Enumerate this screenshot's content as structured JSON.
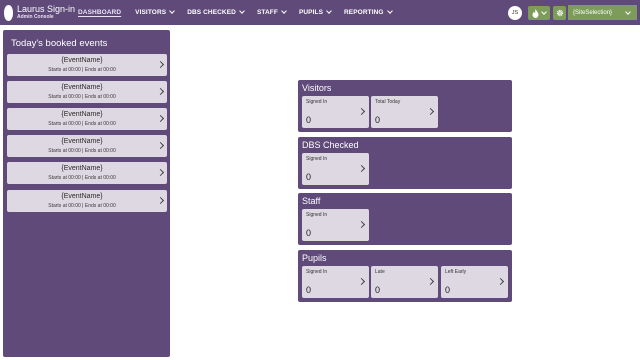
{
  "app": {
    "title": "Laurus Sign-in",
    "subtitle": "Admin Console"
  },
  "nav": {
    "items": [
      {
        "label": "DASHBOARD",
        "active": true
      },
      {
        "label": "VISITORS",
        "dropdown": true
      },
      {
        "label": "DBS CHECKED",
        "dropdown": true
      },
      {
        "label": "STAFF",
        "dropdown": true
      },
      {
        "label": "PUPILS",
        "dropdown": true
      },
      {
        "label": "REPORTING",
        "dropdown": true
      }
    ],
    "user_initials": "JS",
    "site_selection": "{SiteSelection}",
    "icons": [
      "fire-icon",
      "gear-icon"
    ]
  },
  "events": {
    "title": "Today's booked events",
    "items": [
      {
        "name": "{EventName}",
        "starts": "Starts at 00:00",
        "ends": "Ends at 00:00"
      },
      {
        "name": "{EventName}",
        "starts": "Starts at 00:00",
        "ends": "Ends at 00:00"
      },
      {
        "name": "{EventName}",
        "starts": "Starts at 00:00",
        "ends": "Ends at 00:00"
      },
      {
        "name": "{EventName}",
        "starts": "Starts at 00:00",
        "ends": "Ends at 00:00"
      },
      {
        "name": "{EventName}",
        "starts": "Starts at 00:00",
        "ends": "Ends at 00:00"
      },
      {
        "name": "{EventName}",
        "starts": "Starts at 00:00",
        "ends": "Ends at 00:00"
      }
    ],
    "separator": "|"
  },
  "sections": {
    "visitors": {
      "title": "Visitors",
      "stats": [
        {
          "label": "Signed In",
          "value": "0"
        },
        {
          "label": "Total Today",
          "value": "0"
        }
      ]
    },
    "dbs": {
      "title": "DBS Checked",
      "stats": [
        {
          "label": "Signed In",
          "value": "0"
        }
      ]
    },
    "staff": {
      "title": "Staff",
      "stats": [
        {
          "label": "Signed In",
          "value": "0"
        }
      ]
    },
    "pupils": {
      "title": "Pupils",
      "stats": [
        {
          "label": "Signed In",
          "value": "0"
        },
        {
          "label": "Late",
          "value": "0"
        },
        {
          "label": "Left Early",
          "value": "0"
        }
      ]
    }
  },
  "colors": {
    "primary": "#5f4a7a",
    "card": "#ddd8e2",
    "accent_green": "#7d9c5a"
  }
}
